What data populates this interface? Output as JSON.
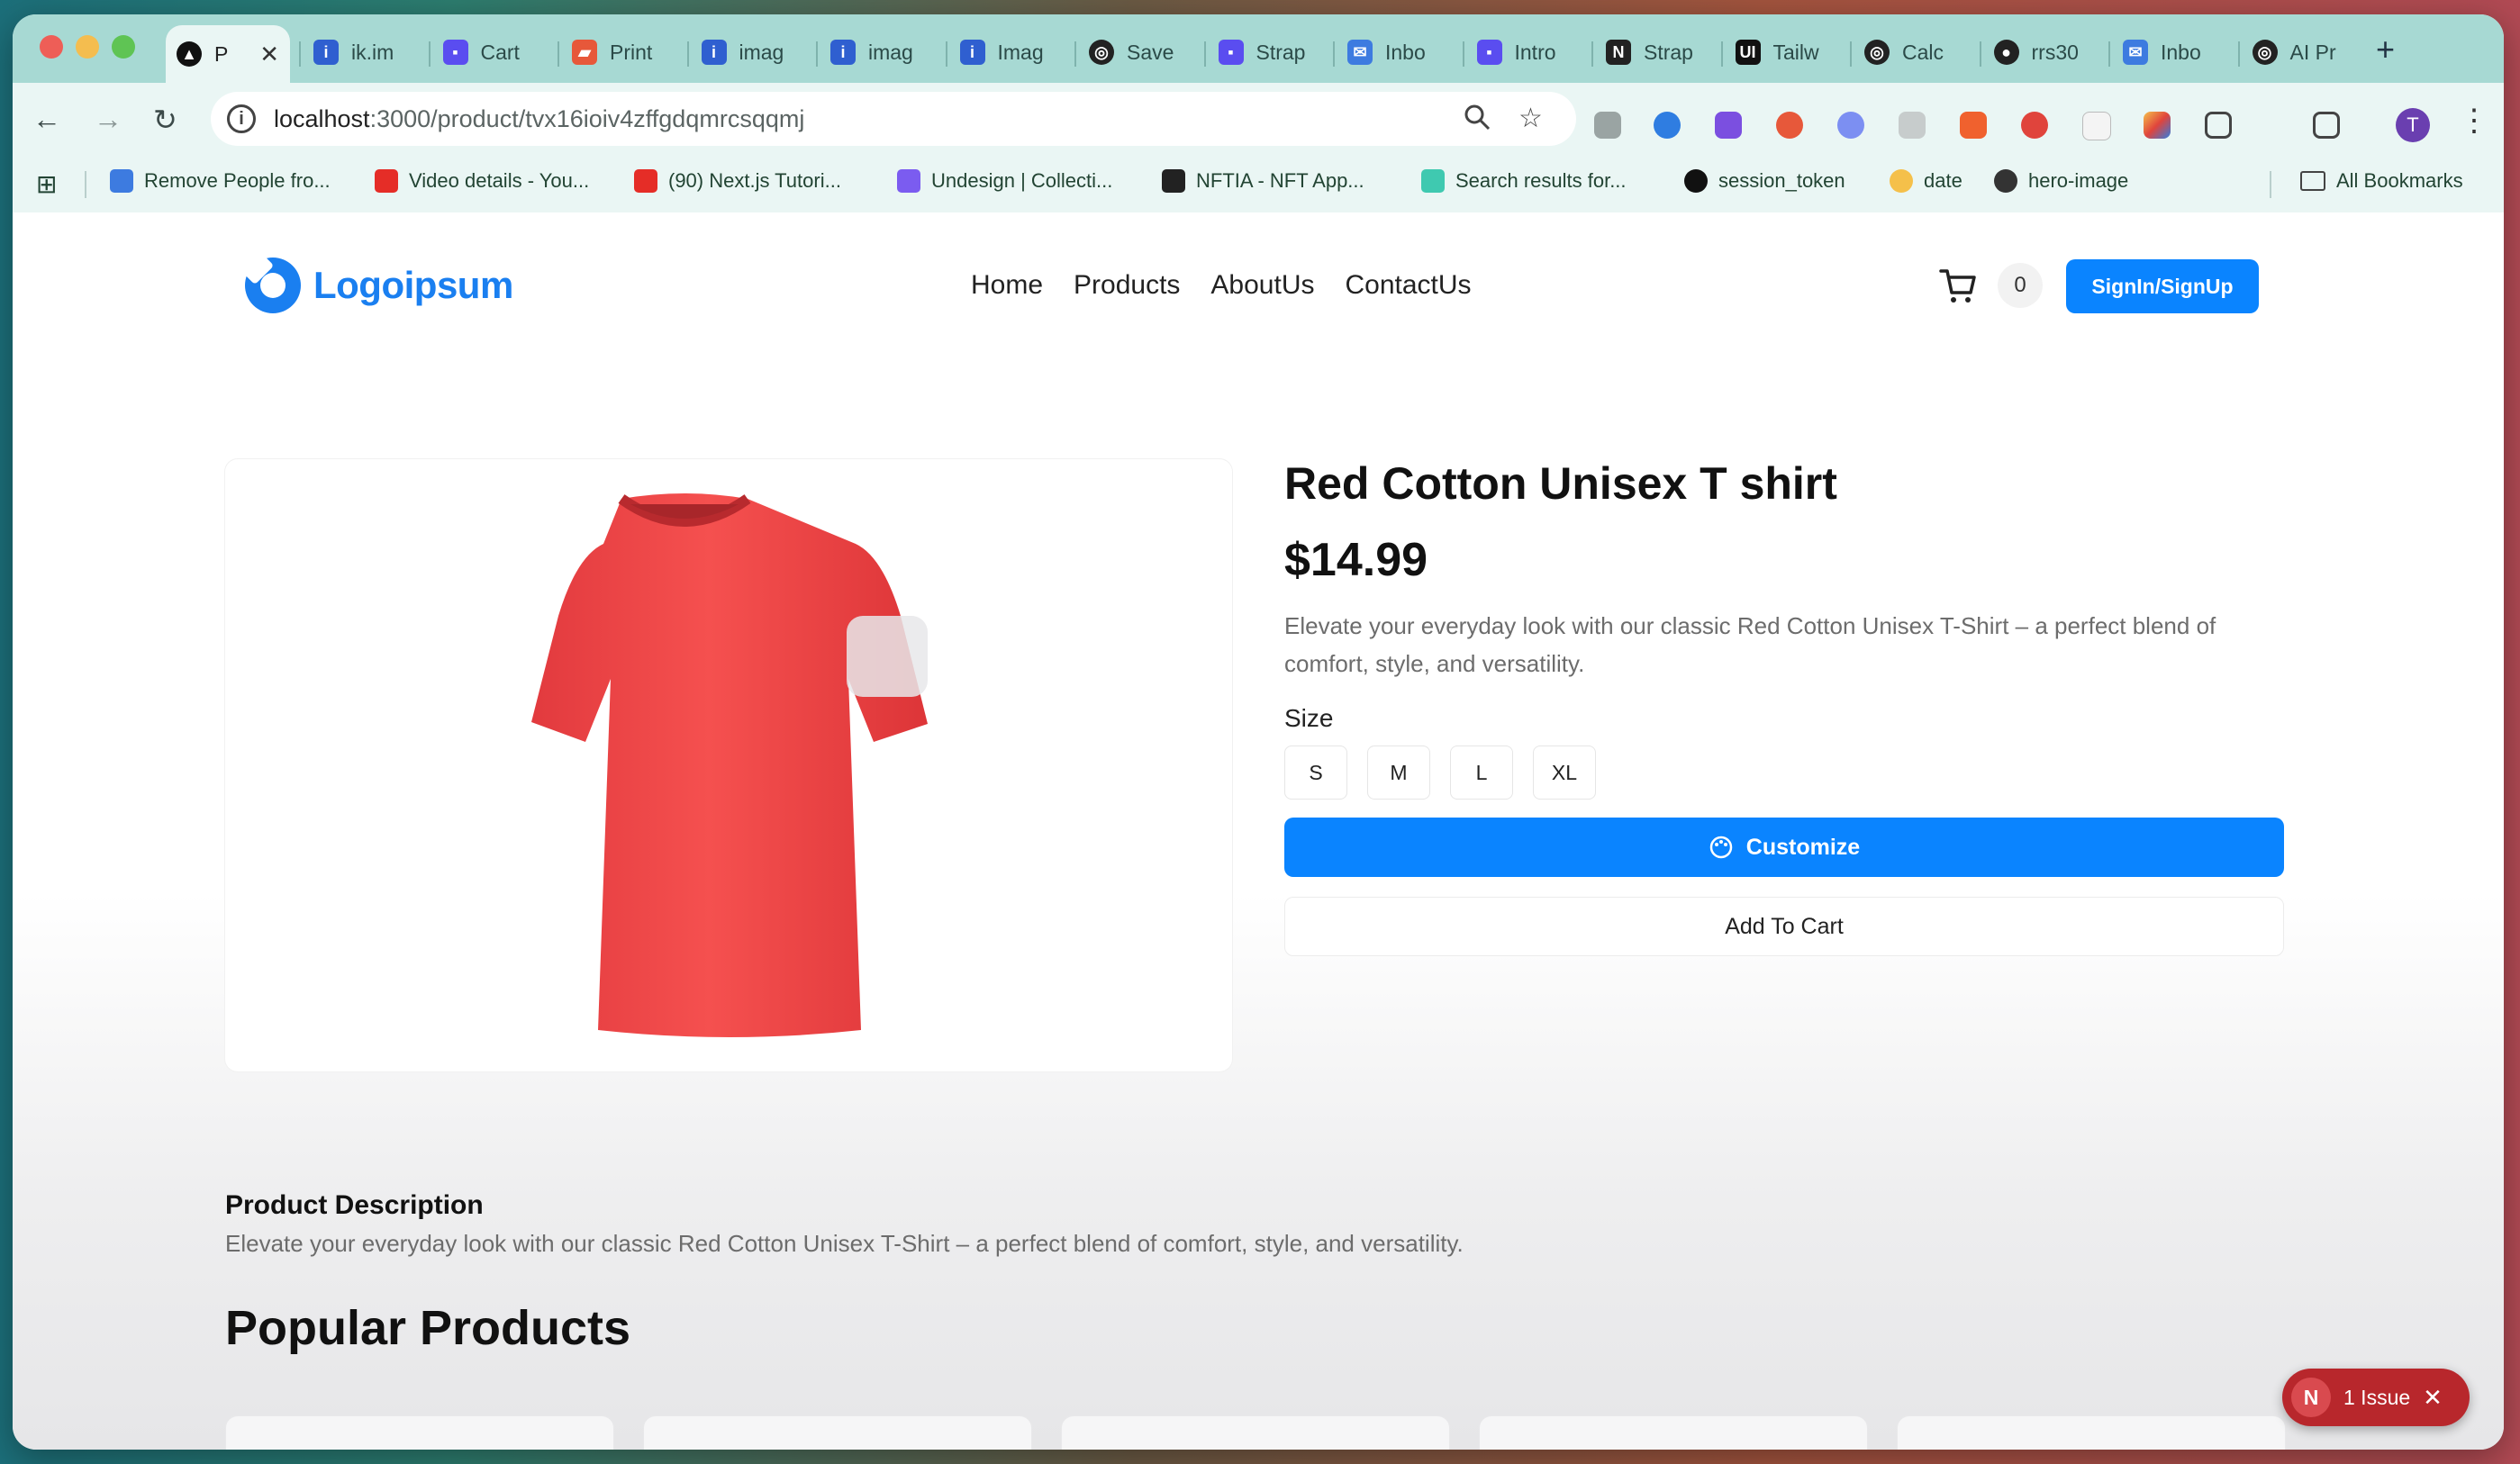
{
  "browser": {
    "active_tab_label": "P",
    "tabs": [
      {
        "label": "ik.im",
        "icon": "i-favicon"
      },
      {
        "label": "Cart",
        "icon": "strapi-favicon"
      },
      {
        "label": "Print",
        "icon": "print-favicon"
      },
      {
        "label": "imag",
        "icon": "i-favicon"
      },
      {
        "label": "imag",
        "icon": "i-favicon"
      },
      {
        "label": "Imag",
        "icon": "i-favicon"
      },
      {
        "label": "Save",
        "icon": "openai-favicon"
      },
      {
        "label": "Strap",
        "icon": "strapi-favicon"
      },
      {
        "label": "Inbo",
        "icon": "mail-favicon"
      },
      {
        "label": "Intro",
        "icon": "strapi-favicon"
      },
      {
        "label": "Strap",
        "icon": "notion-favicon"
      },
      {
        "label": "Tailw",
        "icon": "ui-favicon"
      },
      {
        "label": "Calc",
        "icon": "openai-favicon"
      },
      {
        "label": "rrs30",
        "icon": "github-favicon"
      },
      {
        "label": "Inbo",
        "icon": "mail-favicon"
      },
      {
        "label": "AI Pr",
        "icon": "openai-favicon"
      }
    ],
    "new_tab": "+",
    "url_host": "localhost",
    "url_path": ":3000/product/tvx16ioiv4zffgdqmrcsqqmj",
    "bookmarks": [
      {
        "label": "Remove People fro...",
        "color": "#3d7be0"
      },
      {
        "label": "Video details - You...",
        "color": "#e52d27"
      },
      {
        "label": "(90) Next.js Tutori...",
        "color": "#e52d27"
      },
      {
        "label": "Undesign | Collecti...",
        "color": "#7b5cf0"
      },
      {
        "label": "NFTIA - NFT App...",
        "color": "#222222"
      },
      {
        "label": "Search results for...",
        "color": "#3fc9b0"
      },
      {
        "label": "session_token",
        "color": "#111111"
      },
      {
        "label": "date",
        "color": "#f5c04a"
      },
      {
        "label": "hero-image",
        "color": "#333333"
      }
    ],
    "all_bookmarks": "All Bookmarks",
    "profile_initial": "T"
  },
  "site": {
    "logo_text": "Logoipsum",
    "nav": [
      "Home",
      "Products",
      "AboutUs",
      "ContactUs"
    ],
    "cart_count": "0",
    "signin_label": "SignIn/SignUp",
    "accent_color": "#0a84ff"
  },
  "product": {
    "title": "Red Cotton Unisex T shirt",
    "price": "$14.99",
    "short_description": "Elevate your everyday look with our classic Red Cotton Unisex T-Shirt – a perfect blend of comfort, style, and versatility.",
    "size_label": "Size",
    "sizes": [
      "S",
      "M",
      "L",
      "XL"
    ],
    "customize_label": "Customize",
    "add_to_cart_label": "Add To Cart",
    "description_heading": "Product Description",
    "description_text": "Elevate your everyday look with our classic Red Cotton Unisex T-Shirt – a perfect blend of comfort, style, and versatility.",
    "shirt_color": "#f24a4a"
  },
  "popular": {
    "heading": "Popular Products"
  },
  "devtools": {
    "issue_badge_letter": "N",
    "issue_label": "1 Issue",
    "close": "✕"
  }
}
